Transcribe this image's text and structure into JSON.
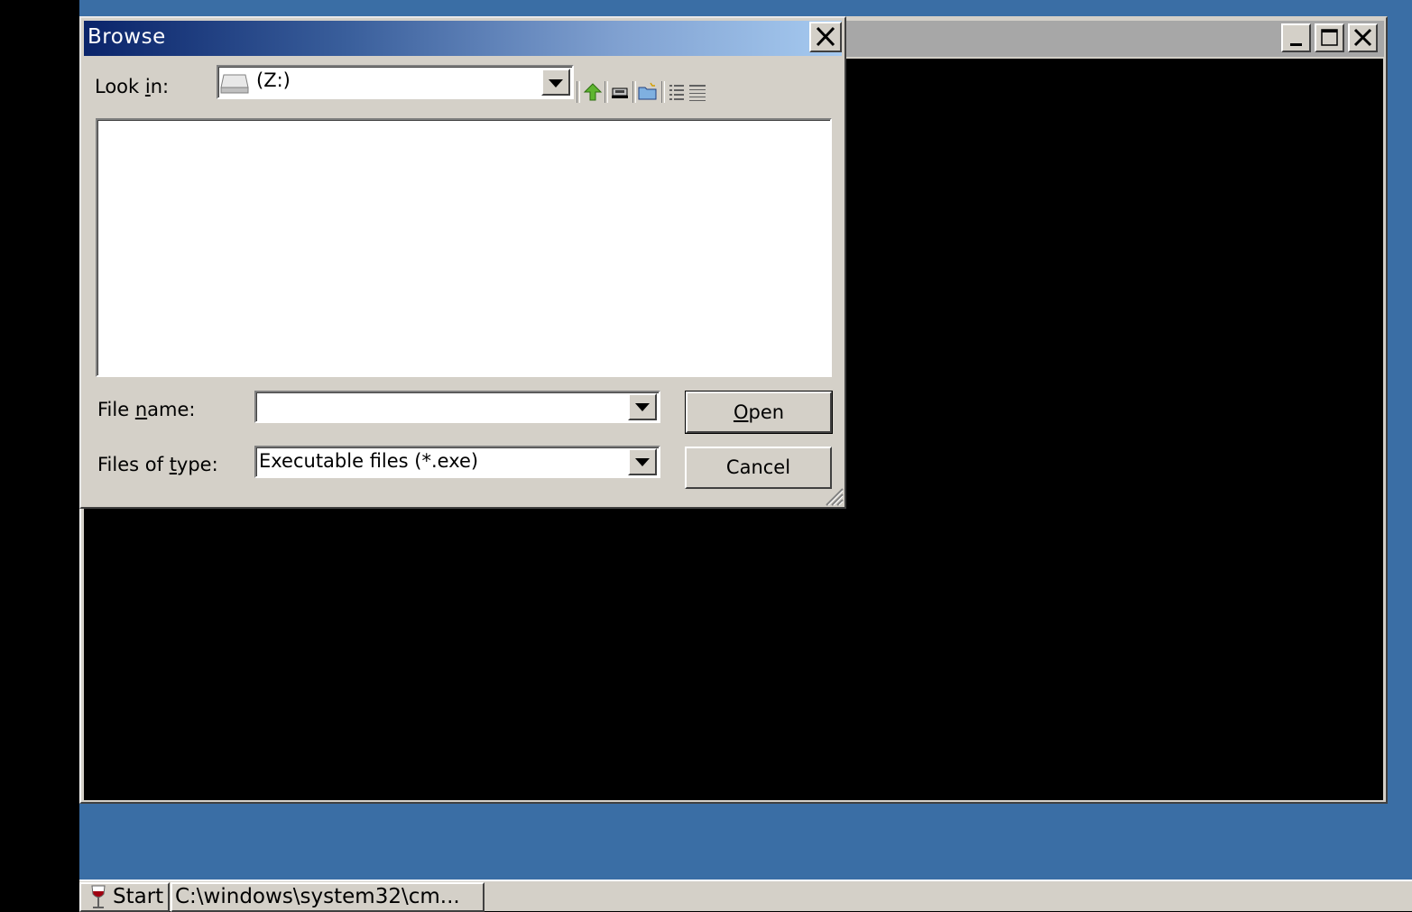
{
  "dialog": {
    "title": "Browse",
    "look_in_label_pre": "Look ",
    "look_in_label_ul": "i",
    "look_in_label_post": "n:",
    "look_in_value": "(Z:)",
    "file_name_label_pre": "File ",
    "file_name_label_ul": "n",
    "file_name_label_post": "ame:",
    "file_name_value": "",
    "files_of_type_label_pre": "Files of ",
    "files_of_type_label_ul": "t",
    "files_of_type_label_post": "ype:",
    "files_of_type_value": "Executable files (*.exe)",
    "open_label_ul": "O",
    "open_label_post": "pen",
    "cancel_label": "Cancel",
    "toolbar_icons": [
      "up-folder-icon",
      "desktop-icon",
      "new-folder-icon",
      "list-view-icon",
      "details-view-icon"
    ]
  },
  "taskbar": {
    "start_label": "Start",
    "task_label": "C:\\windows\\system32\\cm..."
  },
  "colors": {
    "desktop": "#3a6ea5",
    "title_active_start": "#0a246a",
    "title_active_end": "#a6caf0",
    "face": "#d4d0c8"
  }
}
